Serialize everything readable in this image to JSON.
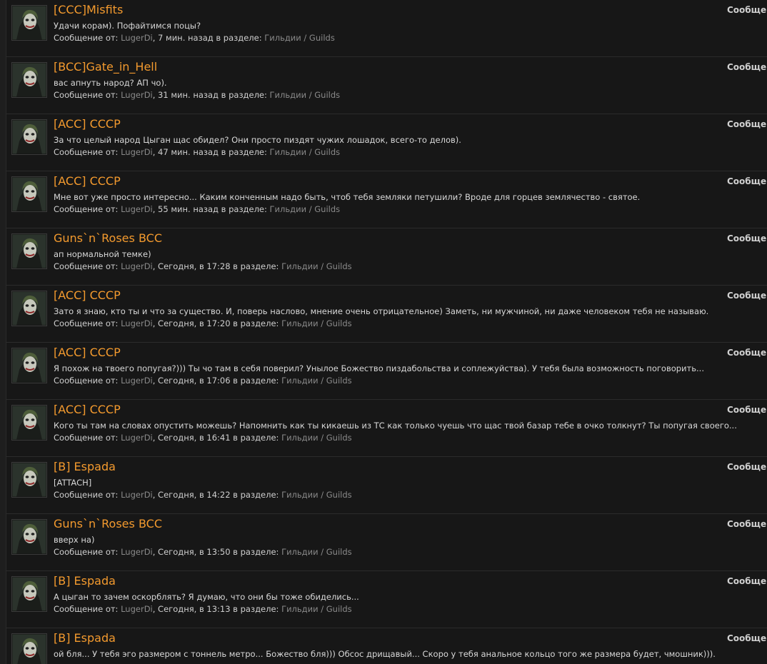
{
  "results": [
    {
      "title": "[CCC]Misfits",
      "snippet": "Удачи корам). Пофайтимся поцы?",
      "meta_prefix": "Сообщение от: ",
      "author": "LugerDi",
      "time": ", 7 мин. назад в разделе: ",
      "forum": "Гильдии / Guilds",
      "type": "Сообщение"
    },
    {
      "title": "[BCC]Gate_in_Hell",
      "snippet": "вас апнуть народ? АП чо).",
      "meta_prefix": "Сообщение от: ",
      "author": "LugerDi",
      "time": ", 31 мин. назад в разделе: ",
      "forum": "Гильдии / Guilds",
      "type": "Сообщение"
    },
    {
      "title": "[ACC] СССР",
      "snippet": "За что целый народ Цыган щас обидел? Они просто пиздят чужих лошадок, всего-то делов).",
      "meta_prefix": "Сообщение от: ",
      "author": "LugerDi",
      "time": ", 47 мин. назад в разделе: ",
      "forum": "Гильдии / Guilds",
      "type": "Сообщение"
    },
    {
      "title": "[ACC] СССР",
      "snippet": "Мне вот уже просто интересно... Каким конченным надо быть, чтоб тебя земляки петушили? Вроде для горцев землячество - святое.",
      "meta_prefix": "Сообщение от: ",
      "author": "LugerDi",
      "time": ", 55 мин. назад в разделе: ",
      "forum": "Гильдии / Guilds",
      "type": "Сообщение"
    },
    {
      "title": "Guns`n`Roses BCC",
      "snippet": "ап нормальной темке)",
      "meta_prefix": "Сообщение от: ",
      "author": "LugerDi",
      "time": ", Сегодня, в 17:28 в разделе: ",
      "forum": "Гильдии / Guilds",
      "type": "Сообщение"
    },
    {
      "title": "[ACC] СССР",
      "snippet": "Зато я знаю, кто ты и что за существо. И, поверь наслово, мнение очень отрицательное) Заметь, ни мужчиной, ни даже человеком тебя не называю.",
      "meta_prefix": "Сообщение от: ",
      "author": "LugerDi",
      "time": ", Сегодня, в 17:20 в разделе: ",
      "forum": "Гильдии / Guilds",
      "type": "Сообщение"
    },
    {
      "title": "[ACC] СССР",
      "snippet": "Я похож на твоего попугая?))) Ты чо там в себя поверил? Унылое Божество пиздабольства и соплежуйства). У тебя была возможность поговорить...",
      "meta_prefix": "Сообщение от: ",
      "author": "LugerDi",
      "time": ", Сегодня, в 17:06 в разделе: ",
      "forum": "Гильдии / Guilds",
      "type": "Сообщение"
    },
    {
      "title": "[ACC] СССР",
      "snippet": "Кого ты там на словах опустить можешь? Напомнить как ты кикаешь из ТС как только чуешь что щас твой базар тебе в очко толкнут? Ты попугая своего...",
      "meta_prefix": "Сообщение от: ",
      "author": "LugerDi",
      "time": ", Сегодня, в 16:41 в разделе: ",
      "forum": "Гильдии / Guilds",
      "type": "Сообщение"
    },
    {
      "title": "[B] Espada",
      "snippet": "[ATTACH]",
      "meta_prefix": "Сообщение от: ",
      "author": "LugerDi",
      "time": ", Сегодня, в 14:22 в разделе: ",
      "forum": "Гильдии / Guilds",
      "type": "Сообщение"
    },
    {
      "title": "Guns`n`Roses BCC",
      "snippet": "вверх на)",
      "meta_prefix": "Сообщение от: ",
      "author": "LugerDi",
      "time": ", Сегодня, в 13:50 в разделе: ",
      "forum": "Гильдии / Guilds",
      "type": "Сообщение"
    },
    {
      "title": "[B] Espada",
      "snippet": "А цыган то зачем оскорблять? Я думаю, что они бы тоже обиделись...",
      "meta_prefix": "Сообщение от: ",
      "author": "LugerDi",
      "time": ", Сегодня, в 13:13 в разделе: ",
      "forum": "Гильдии / Guilds",
      "type": "Сообщение"
    },
    {
      "title": "[B] Espada",
      "snippet": "ой бля... У тебя эго размером с тоннель метро... Божество бля))) Обсос дрищавый... Скоро у тебя анальное кольцо того же размера будет, чмошник))).",
      "meta_prefix": "",
      "author": "",
      "time": "",
      "forum": "",
      "type": "Сообщение"
    }
  ],
  "colors": {
    "background": "#171717",
    "title": "#f39a2e",
    "link_muted": "#8a8a8a",
    "text": "#d8d8d8"
  },
  "icons": {
    "avatar": "joker-avatar-icon"
  }
}
